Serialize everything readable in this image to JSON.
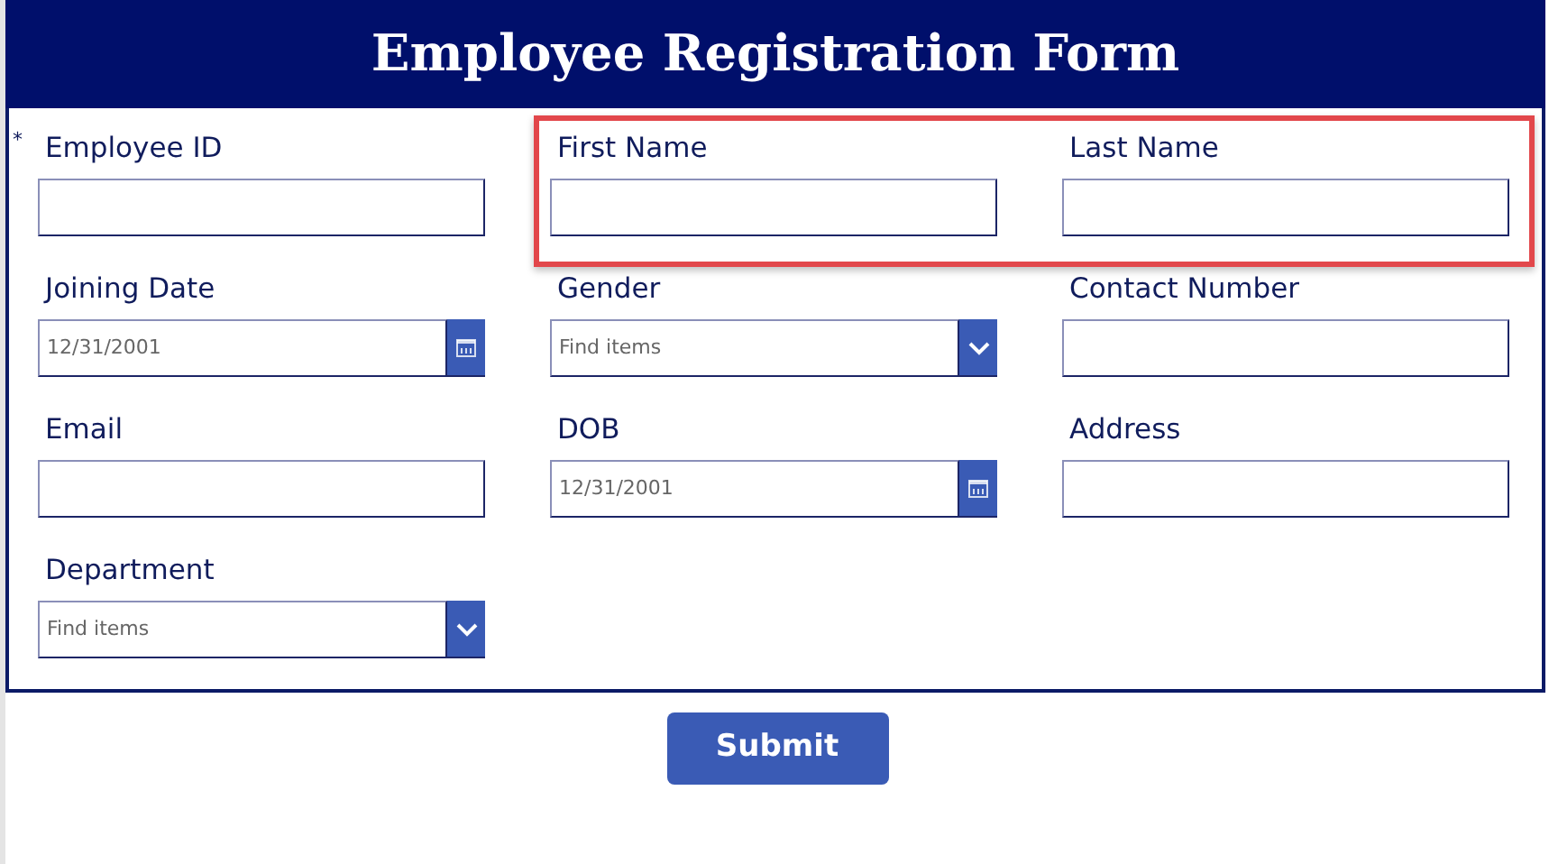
{
  "title": "Employee Registration Form",
  "fields": [
    {
      "label": "Employee ID",
      "kind": "text",
      "required": true,
      "highlighted": false
    },
    {
      "label": "First Name",
      "kind": "text",
      "required": false,
      "highlighted": true
    },
    {
      "label": "Last Name",
      "kind": "text",
      "required": false,
      "highlighted": true
    },
    {
      "label": "Joining Date",
      "kind": "date",
      "value": "12/31/2001",
      "required": false,
      "highlighted": false
    },
    {
      "label": "Gender",
      "kind": "dropdown",
      "placeholder": "Find items",
      "required": false,
      "highlighted": false
    },
    {
      "label": "Contact Number",
      "kind": "text",
      "required": false,
      "highlighted": false
    },
    {
      "label": "Email",
      "kind": "text",
      "required": false,
      "highlighted": false
    },
    {
      "label": "DOB",
      "kind": "date",
      "value": "12/31/2001",
      "required": false,
      "highlighted": false
    },
    {
      "label": "Address",
      "kind": "text",
      "required": false,
      "highlighted": false
    },
    {
      "label": "Department",
      "kind": "dropdown",
      "placeholder": "Find items",
      "required": false,
      "highlighted": false
    }
  ],
  "required_mark": "*",
  "submit": "Submit"
}
